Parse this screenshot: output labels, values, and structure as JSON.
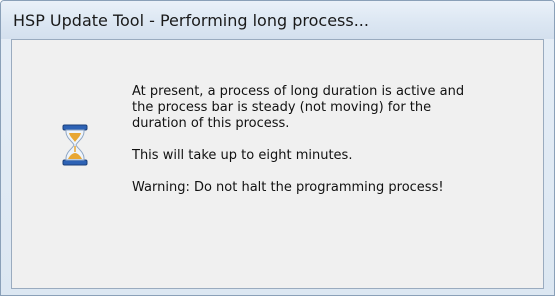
{
  "window": {
    "title": "HSP Update Tool - Performing long process..."
  },
  "icon": {
    "name": "hourglass-icon"
  },
  "message": {
    "paragraph1_lines": [
      "At present, a process of long duration is active and",
      "the process bar is steady (not moving) for the",
      "duration of this process."
    ],
    "paragraph2": "This will take up to eight minutes.",
    "paragraph3": "Warning: Do not halt the programming process!"
  }
}
